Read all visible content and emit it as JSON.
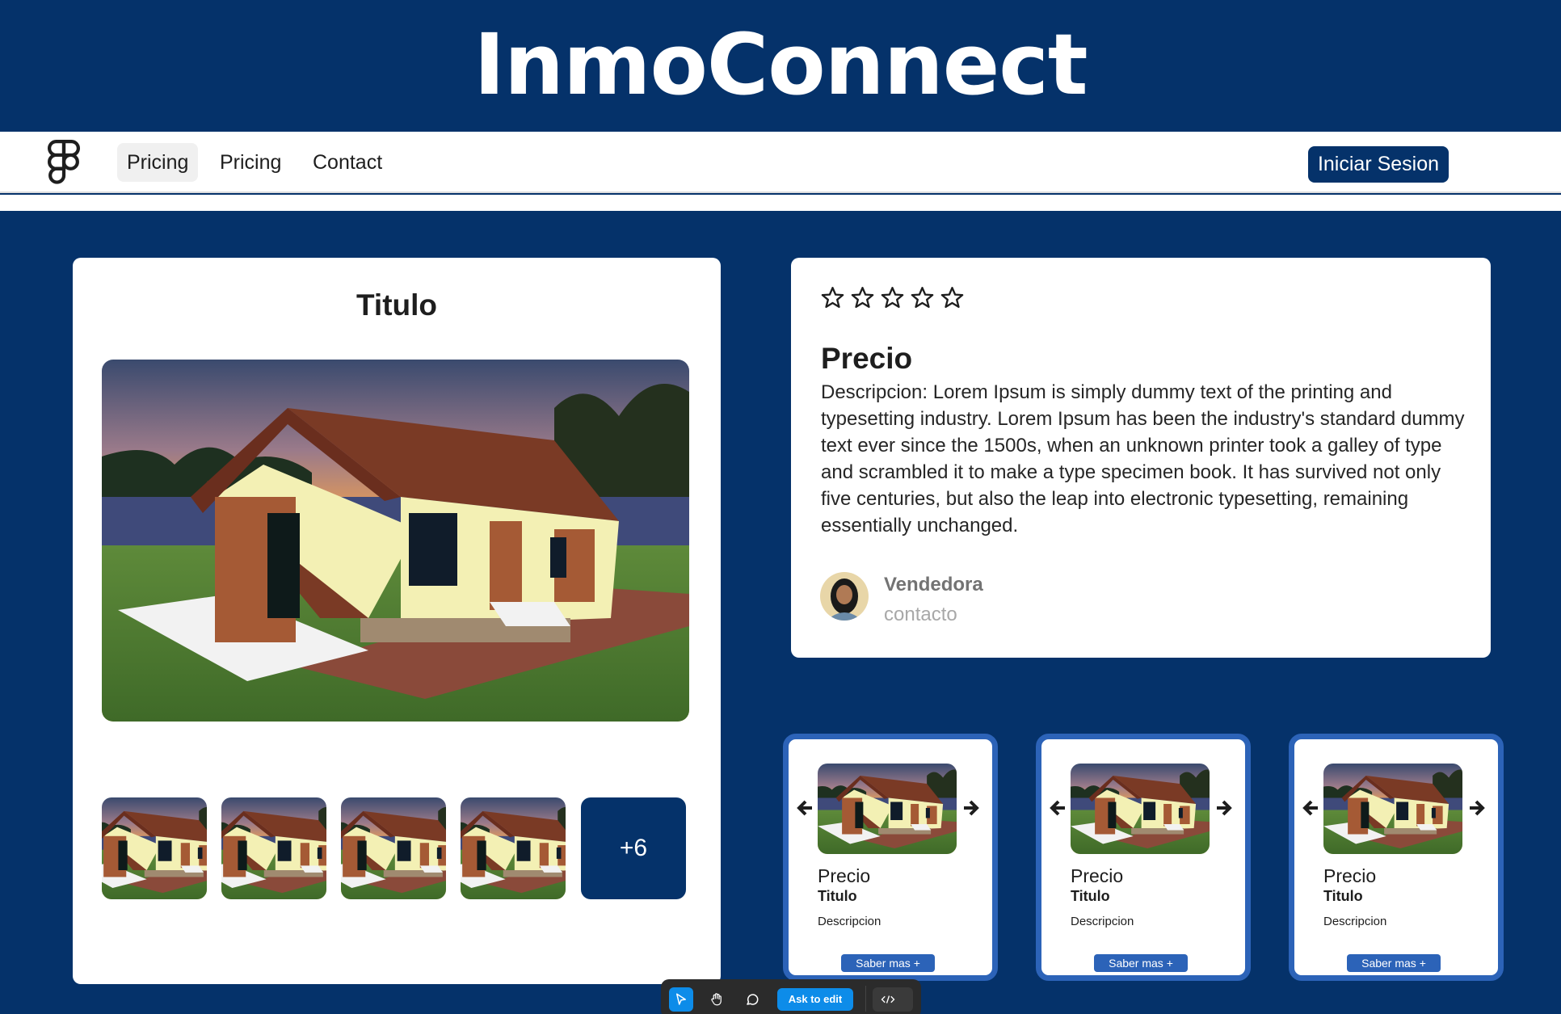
{
  "header": {
    "brand": "InmoConnect"
  },
  "nav": {
    "items": [
      {
        "label": "Pricing",
        "active": true
      },
      {
        "label": "Pricing",
        "active": false
      },
      {
        "label": "Contact",
        "active": false
      }
    ],
    "login_label": "Iniciar Sesion"
  },
  "listing": {
    "title": "Titulo",
    "more_photos": "+6",
    "rating": 0,
    "price_heading": "Precio",
    "description": "Descripcion: Lorem Ipsum is simply dummy text of the printing and typesetting industry. Lorem Ipsum has been the industry's standard dummy text ever since the 1500s, when an unknown printer took a galley of type and scrambled it to make a type specimen book. It has survived not only five centuries, but also the leap into electronic typesetting, remaining essentially unchanged.",
    "seller": {
      "name": "Vendedora",
      "contact": "contacto"
    }
  },
  "related": [
    {
      "price": "Precio",
      "title": "Titulo",
      "description": "Descripcion",
      "button": "Saber mas +"
    },
    {
      "price": "Precio",
      "title": "Titulo",
      "description": "Descripcion",
      "button": "Saber mas +"
    },
    {
      "price": "Precio",
      "title": "Titulo",
      "description": "Descripcion",
      "button": "Saber mas +"
    }
  ],
  "toolbar": {
    "ask_label": "Ask to edit"
  },
  "colors": {
    "primary": "#05326a",
    "accent": "#2c63b8",
    "tool_accent": "#0d8ce9"
  },
  "icons": [
    "figma-logo-icon",
    "star-outline-icon",
    "arrow-left-icon",
    "arrow-right-icon",
    "pointer-icon",
    "hand-icon",
    "comment-icon",
    "code-icon"
  ]
}
